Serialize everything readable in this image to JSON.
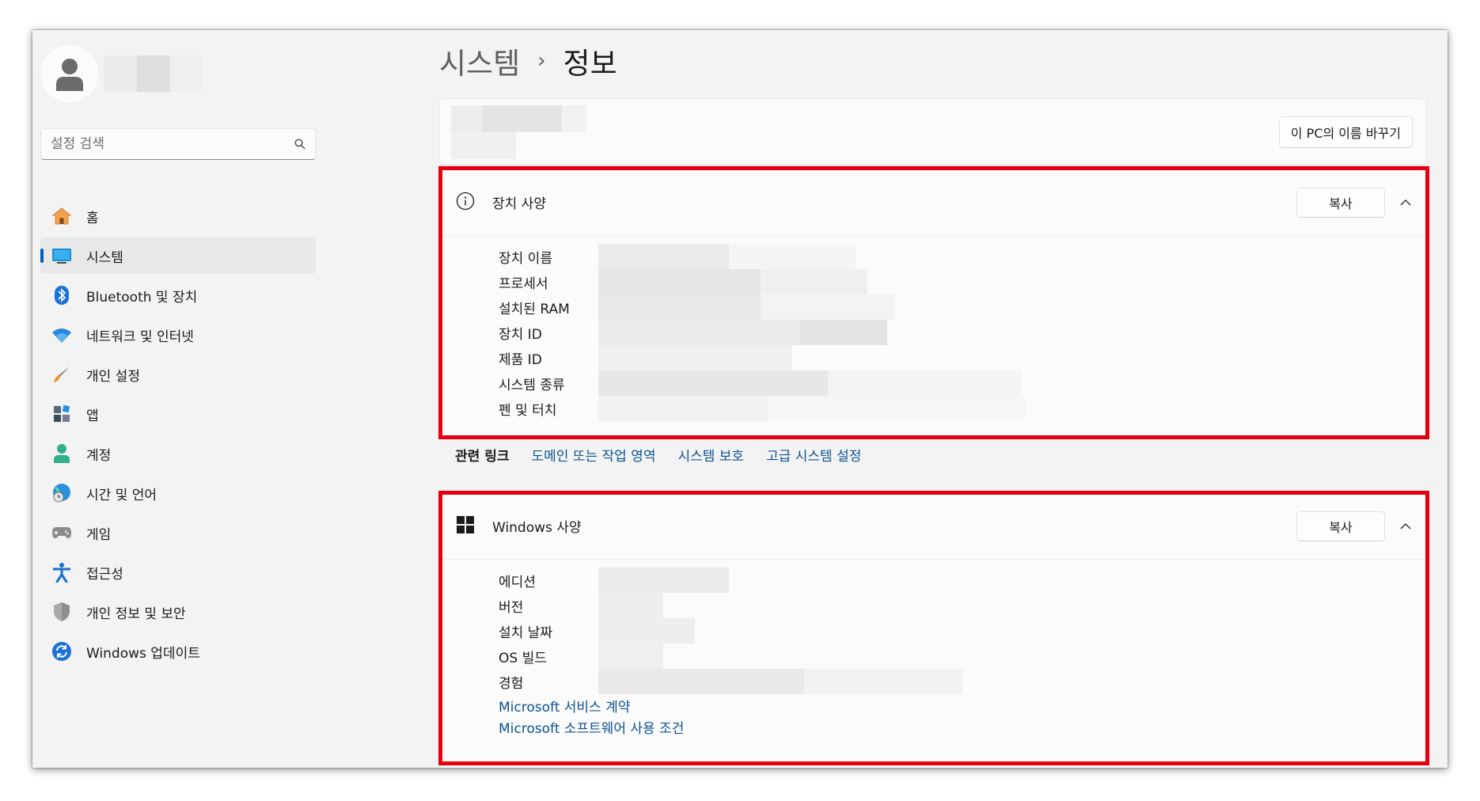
{
  "breadcrumb": {
    "parent": "시스템",
    "separator": "›",
    "current": "정보"
  },
  "search": {
    "placeholder": "설정 검색"
  },
  "nav": [
    {
      "label": "홈",
      "icon": "home-icon"
    },
    {
      "label": "시스템",
      "icon": "system-icon",
      "active": true
    },
    {
      "label": "Bluetooth 및 장치",
      "icon": "bluetooth-icon"
    },
    {
      "label": "네트워크 및 인터넷",
      "icon": "wifi-icon"
    },
    {
      "label": "개인 설정",
      "icon": "brush-icon"
    },
    {
      "label": "앱",
      "icon": "apps-icon"
    },
    {
      "label": "계정",
      "icon": "account-icon"
    },
    {
      "label": "시간 및 언어",
      "icon": "globe-clock-icon"
    },
    {
      "label": "게임",
      "icon": "gamepad-icon"
    },
    {
      "label": "접근성",
      "icon": "accessibility-icon"
    },
    {
      "label": "개인 정보 및 보안",
      "icon": "shield-icon"
    },
    {
      "label": "Windows 업데이트",
      "icon": "update-icon"
    }
  ],
  "top_card": {
    "rename_label": "이 PC의 이름 바꾸기"
  },
  "device_specs": {
    "title": "장치 사양",
    "copy_label": "복사",
    "rows": [
      "장치 이름",
      "프로세서",
      "설치된 RAM",
      "장치 ID",
      "제품 ID",
      "시스템 종류",
      "펜 및 터치"
    ]
  },
  "related": {
    "title": "관련 링크",
    "links": [
      "도메인 또는 작업 영역",
      "시스템 보호",
      "고급 시스템 설정"
    ]
  },
  "windows_specs": {
    "title": "Windows 사양",
    "copy_label": "복사",
    "rows": [
      "에디션",
      "버전",
      "설치 날짜",
      "OS 빌드",
      "경험"
    ],
    "links": [
      "Microsoft 서비스 계약",
      "Microsoft 소프트웨어 사용 조건"
    ]
  },
  "colors": {
    "accent": "#005fb8",
    "link": "#0b5394",
    "highlight_box": "#e5000f"
  }
}
